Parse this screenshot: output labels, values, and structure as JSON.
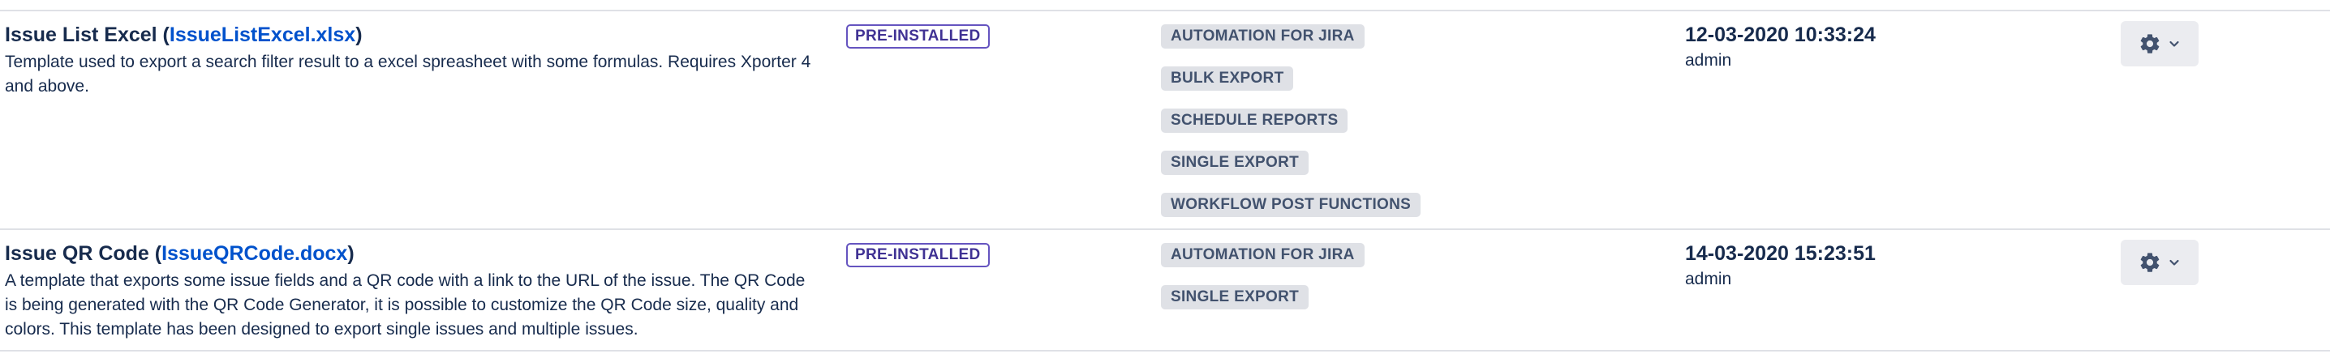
{
  "templates": [
    {
      "title_prefix": "Issue List Excel (",
      "file": "IssueListExcel.xlsx",
      "title_suffix": ")",
      "description": "Template used to export a search filter result to a excel spreasheet with some formulas. Requires Xporter 4 and above.",
      "status": "PRE-INSTALLED",
      "tags": [
        "AUTOMATION FOR JIRA",
        "BULK EXPORT",
        "SCHEDULE REPORTS",
        "SINGLE EXPORT",
        "WORKFLOW POST FUNCTIONS"
      ],
      "date": "12-03-2020 10:33:24",
      "author": "admin",
      "actions_icon": "gear-icon",
      "dropdown_icon": "chevron-down-icon"
    },
    {
      "title_prefix": "Issue QR Code (",
      "file": "IssueQRCode.docx",
      "title_suffix": ")",
      "description": "A template that exports some issue fields and a QR code with a link to the URL of the issue. The QR Code is being generated with the QR Code Generator, it is possible to customize the QR Code size, quality and colors. This template has been designed to export single issues and multiple issues.",
      "status": "PRE-INSTALLED",
      "tags": [
        "AUTOMATION FOR JIRA",
        "SINGLE EXPORT"
      ],
      "date": "14-03-2020 15:23:51",
      "author": "admin",
      "actions_icon": "gear-icon",
      "dropdown_icon": "chevron-down-icon"
    }
  ],
  "colors": {
    "link": "#0052cc",
    "text": "#172b4d",
    "lozenge_border": "#6554c0",
    "lozenge_text": "#403294",
    "tag_bg": "#dfe1e6",
    "tag_text": "#42526e",
    "divider": "#dfe1e6",
    "button_bg": "#ebecf0"
  }
}
